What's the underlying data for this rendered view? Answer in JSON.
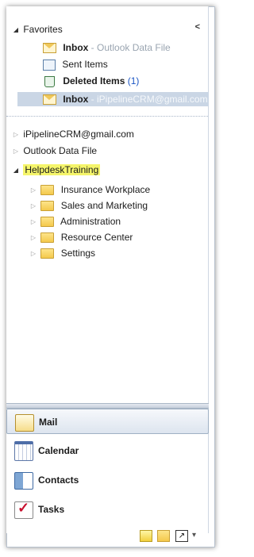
{
  "favorites": {
    "header": "Favorites",
    "collapse_glyph": "<",
    "items": [
      {
        "name": "Inbox",
        "suffix": " - Outlook Data File",
        "icon": "inbox-icon"
      },
      {
        "name": "Sent Items",
        "suffix": "",
        "icon": "sent-items-icon"
      },
      {
        "name": "Deleted Items",
        "count": "(1)",
        "icon": "deleted-items-icon"
      },
      {
        "name": "Inbox",
        "suffix": " - iPipelineCRM@gmail.com",
        "icon": "inbox-icon",
        "selected": true
      }
    ]
  },
  "accounts": [
    {
      "name": "iPipelineCRM@gmail.com",
      "expanded": false
    },
    {
      "name": "Outlook Data File",
      "expanded": false
    },
    {
      "name": "HelpdeskTraining",
      "expanded": true,
      "highlighted": true,
      "folders": [
        "Insurance Workplace",
        "Sales and Marketing",
        "Administration",
        "Resource Center",
        "Settings"
      ]
    }
  ],
  "nav": {
    "mail": "Mail",
    "calendar": "Calendar",
    "contacts": "Contacts",
    "tasks": "Tasks"
  },
  "footer_icons": [
    "notes-icon",
    "folder-list-icon",
    "shortcuts-icon",
    "configure-buttons-icon"
  ],
  "colors": {
    "highlight": "#f5f56b",
    "selected_row": "#cad6e5",
    "deleted_count": "#1a55c4"
  }
}
